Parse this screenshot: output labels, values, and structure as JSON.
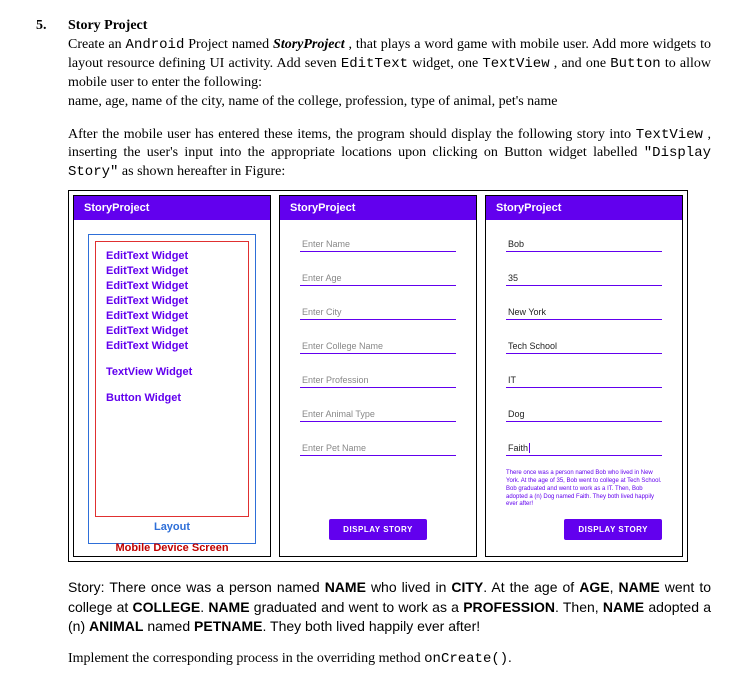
{
  "heading": {
    "number": "5.",
    "title": "Story Project"
  },
  "intro": {
    "p1_a": "Create an ",
    "p1_code1": "Android",
    "p1_b": " Project named ",
    "p1_name": "StoryProject",
    "p1_c": ", that plays a word game with mobile user. Add more widgets to layout resource defining UI activity. Add seven ",
    "p1_code2": "EditText",
    "p1_d": " widget, one ",
    "p1_code3": "TextView",
    "p1_e": ", and one ",
    "p1_code4": "Button",
    "p1_f": " to allow mobile user to enter the following:",
    "p1_list": "name, age, name of the city, name of the college,  profession,  type of animal, pet's name",
    "p2_a": "After the mobile user has entered these items, the program should display the following story into ",
    "p2_code1": "TextView",
    "p2_b": ", inserting the user's input into the appropriate locations upon clicking on Button widget labelled ",
    "p2_code2": "\"Display Story\"",
    "p2_c": " as shown hereafter in Figure:"
  },
  "appbar_title": "StoryProject",
  "panel1": {
    "widgets": [
      "EditText Widget",
      "EditText Widget",
      "EditText Widget",
      "EditText Widget",
      "EditText Widget",
      "EditText Widget",
      "EditText Widget"
    ],
    "textview": "TextView Widget",
    "button": "Button Widget",
    "layout_caption": "Layout",
    "screen_caption": "Mobile Device Screen"
  },
  "panel2": {
    "hints": [
      "Enter Name",
      "Enter Age",
      "Enter City",
      "Enter College Name",
      "Enter Profession",
      "Enter Animal Type",
      "Enter Pet Name"
    ],
    "button": "DISPLAY STORY"
  },
  "panel3": {
    "values": [
      "Bob",
      "35",
      "New York",
      "Tech School",
      "IT",
      "Dog",
      "Faith"
    ],
    "story": "There once was a person named Bob who lived in New York. At the age of 35, Bob went to college at Tech School. Bob graduated and went to work as a IT. Then, Bob adopted a (n) Dog named Faith. They both lived happily ever after!",
    "button": "DISPLAY STORY"
  },
  "story_template": {
    "line1a": "Story: There once was a person named ",
    "w_name": "NAME",
    "line1b": " who lived in ",
    "w_city": "CITY",
    "line1c": ". At the age of ",
    "w_age": "AGE",
    "line2a": ", ",
    "line2b": " went to college at ",
    "w_college": "COLLEGE",
    "line2c": ". ",
    "line2d": " graduated and went to work as a ",
    "w_prof": "PROFESSION",
    "line3a": ". Then, ",
    "line3b": " adopted a (n) ",
    "w_animal": "ANIMAL",
    "line3c": " named ",
    "w_pet": "PETNAME",
    "line3d": ". They both lived happily ever after!"
  },
  "impl": {
    "a": "Implement the corresponding process in the overriding method ",
    "code": "onCreate()",
    "b": "."
  }
}
